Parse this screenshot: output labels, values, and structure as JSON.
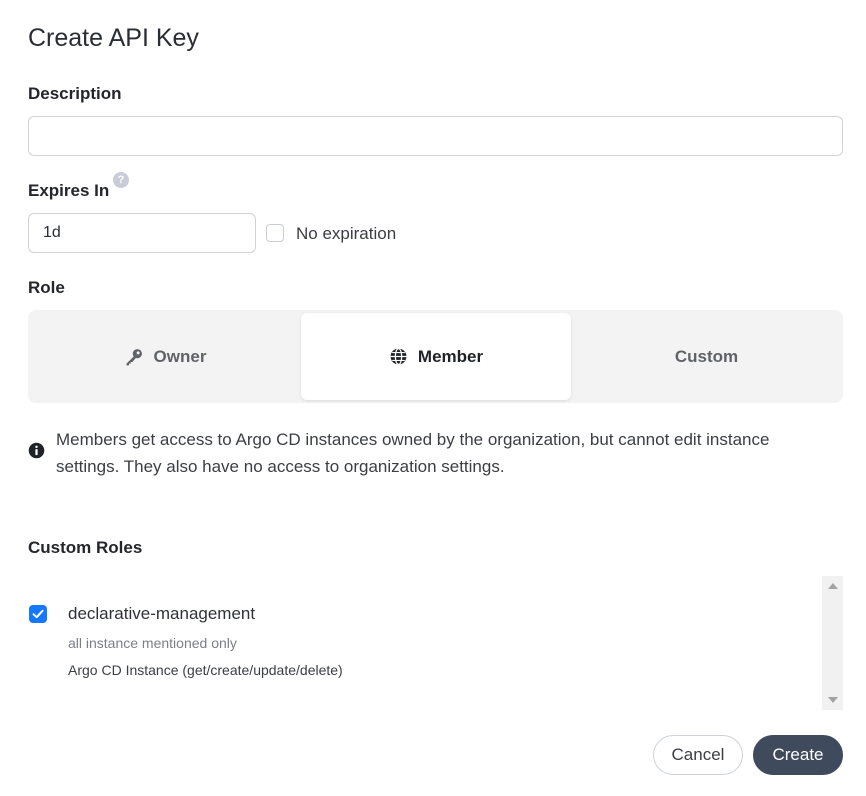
{
  "dialog": {
    "title": "Create API Key"
  },
  "description": {
    "label": "Description",
    "value": "",
    "placeholder": ""
  },
  "expires": {
    "label": "Expires In",
    "help_icon": "question-circle-icon",
    "value": "1d",
    "no_expiration_label": "No expiration",
    "no_expiration_checked": false
  },
  "role": {
    "label": "Role",
    "options": [
      {
        "label": "Owner",
        "icon": "key-icon",
        "selected": false
      },
      {
        "label": "Member",
        "icon": "globe-icon",
        "selected": true
      },
      {
        "label": "Custom",
        "icon": "",
        "selected": false
      }
    ],
    "info_text": "Members get access to Argo CD instances owned by the organization, but cannot edit instance settings. They also have no access to organization settings."
  },
  "custom_roles": {
    "label": "Custom Roles",
    "items": [
      {
        "name": "declarative-management",
        "scope": "all instance mentioned only",
        "permissions": "Argo CD Instance (get/create/update/delete)",
        "checked": true
      }
    ]
  },
  "actions": {
    "cancel_label": "Cancel",
    "create_label": "Create"
  },
  "colors": {
    "primary_button": "#3f4b5c",
    "checkbox_checked": "#1677ff",
    "segment_background": "#f3f3f3"
  }
}
